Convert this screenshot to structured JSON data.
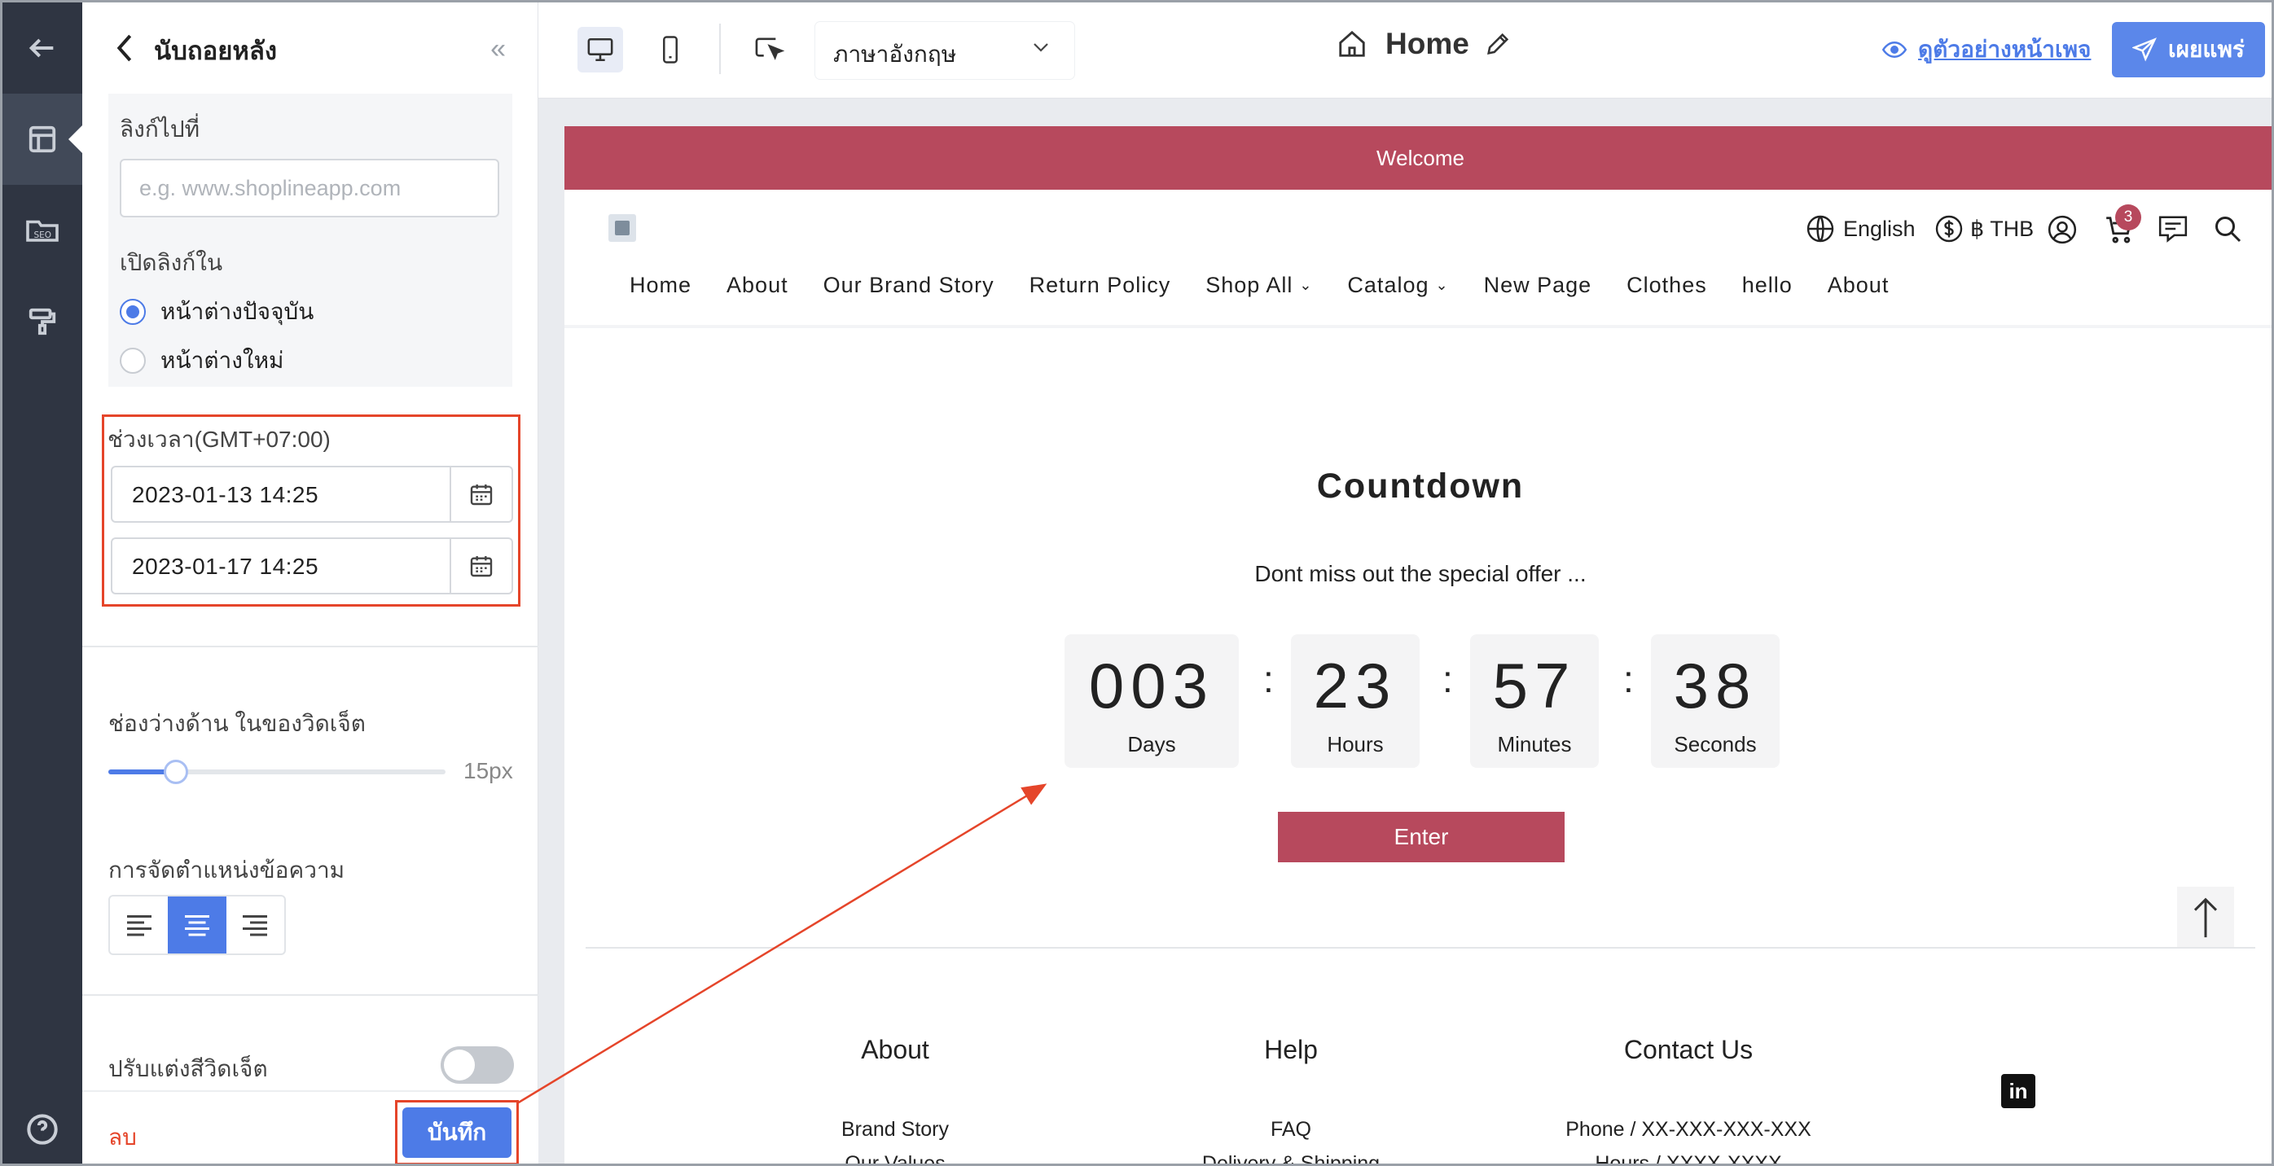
{
  "sidebar": {
    "back_title": "นับถอยหลัง",
    "link_to_label": "ลิงก์ไปที่",
    "link_placeholder": "e.g. www.shoplineapp.com",
    "open_link_in_label": "เปิดลิงก์ใน",
    "radio_current": "หน้าต่างปัจจุบัน",
    "radio_new": "หน้าต่างใหม่",
    "time_range_label": "ช่วงเวลา(GMT+07:00)",
    "start_datetime": "2023-01-13 14:25",
    "end_datetime": "2023-01-17 14:25",
    "padding_label": "ช่องว่างด้าน ในของวิดเจ็ต",
    "padding_value": "15px",
    "padding_fraction": 0.2,
    "text_align_label": "การจัดตำแหน่งข้อความ",
    "widget_color_label": "ปรับแต่งสีวิดเจ็ต",
    "delete_label": "ลบ",
    "save_label": "บันทึก"
  },
  "toolbar": {
    "language": "ภาษาอังกฤษ",
    "page_name": "Home",
    "preview_label": "ดูตัวอย่างหน้าเพจ",
    "publish_label": "เผยแพร่"
  },
  "site": {
    "banner": "Welcome",
    "lang": "English",
    "currency": "฿ THB",
    "cart_count": "3",
    "nav": [
      {
        "label": "Home",
        "dropdown": false
      },
      {
        "label": "About",
        "dropdown": false
      },
      {
        "label": "Our Brand Story",
        "dropdown": false
      },
      {
        "label": "Return Policy",
        "dropdown": false
      },
      {
        "label": "Shop All",
        "dropdown": true
      },
      {
        "label": "Catalog",
        "dropdown": true
      },
      {
        "label": "New Page",
        "dropdown": false
      },
      {
        "label": "Clothes",
        "dropdown": false
      },
      {
        "label": "hello",
        "dropdown": false
      },
      {
        "label": "About",
        "dropdown": false
      }
    ],
    "countdown": {
      "title": "Countdown",
      "subtitle": "Dont miss out the special offer ...",
      "days": "003",
      "days_label": "Days",
      "hours": "23",
      "hours_label": "Hours",
      "minutes": "57",
      "minutes_label": "Minutes",
      "seconds": "38",
      "seconds_label": "Seconds",
      "button": "Enter"
    },
    "footer": {
      "about": "About",
      "help": "Help",
      "contact": "Contact Us",
      "about_link1": "Brand Story",
      "about_link2": "Our Values",
      "help_link1": "FAQ",
      "help_link2": "Delivery & Shipping",
      "contact_link1": "Phone / XX-XXX-XXX-XXX",
      "contact_link2": "Hours / XXXX-XXXX",
      "social": "in"
    }
  },
  "colors": {
    "accent": "#4d7be7",
    "brand": "#b7495d",
    "highlight": "#e5452a",
    "rail": "#2f3542"
  }
}
